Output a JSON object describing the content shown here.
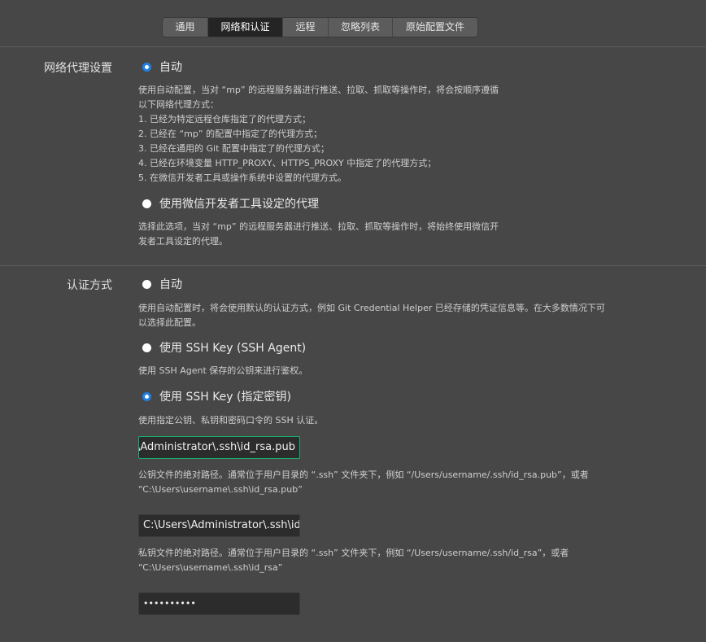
{
  "tabs": [
    {
      "label": "通用",
      "active": false
    },
    {
      "label": "网络和认证",
      "active": true
    },
    {
      "label": "远程",
      "active": false
    },
    {
      "label": "忽略列表",
      "active": false
    },
    {
      "label": "原始配置文件",
      "active": false
    }
  ],
  "proxy": {
    "label": "网络代理设置",
    "options": [
      {
        "label": "自动",
        "checked": true,
        "desc_lines": [
          "使用自动配置，当对 “mp” 的远程服务器进行推送、拉取、抓取等操作时，将会按顺序遵循",
          "以下网络代理方式：",
          "1. 已经为特定远程仓库指定了的代理方式；",
          "2. 已经在 “mp” 的配置中指定了的代理方式；",
          "3. 已经在通用的 Git 配置中指定了的代理方式；",
          "4. 已经在环境变量 HTTP_PROXY、HTTPS_PROXY 中指定了的代理方式；",
          "5. 在微信开发者工具或操作系统中设置的代理方式。"
        ]
      },
      {
        "label": "使用微信开发者工具设定的代理",
        "checked": false,
        "desc_lines": [
          "选择此选项，当对 “mp” 的远程服务器进行推送、拉取、抓取等操作时，将始终使用微信开",
          "发者工具设定的代理。"
        ]
      }
    ]
  },
  "auth": {
    "label": "认证方式",
    "options": [
      {
        "label": "自动",
        "checked": false,
        "desc_lines": [
          "使用自动配置时，将会使用默认的认证方式，例如 Git Credential Helper 已经存储的凭证信息等。在大多数情况下可",
          "以选择此配置。"
        ]
      },
      {
        "label": "使用 SSH Key (SSH Agent)",
        "checked": false,
        "desc_lines": [
          "使用 SSH Agent 保存的公钥来进行鉴权。"
        ]
      },
      {
        "label": "使用 SSH Key (指定密钥)",
        "checked": true,
        "desc_lines": [
          "使用指定公钥、私钥和密码口令的 SSH 认证。"
        ]
      }
    ],
    "public_key": {
      "value": "C:\\Users\\Administrator\\.ssh\\id_rsa.pub",
      "help_lines": [
        "公钥文件的绝对路径。通常位于用户目录的 “.ssh” 文件夹下，例如 “/Users/username/.ssh/id_rsa.pub”，或者",
        "“C:\\Users\\username\\.ssh\\id_rsa.pub”"
      ]
    },
    "private_key": {
      "value": "C:\\Users\\Administrator\\.ssh\\id_",
      "help_lines": [
        "私钥文件的绝对路径。通常位于用户目录的 “.ssh” 文件夹下，例如 “/Users/username/.ssh/id_rsa”，或者",
        "“C:\\Users\\username\\.ssh\\id_rsa”"
      ]
    },
    "passphrase": {
      "value": "••••••••••"
    }
  }
}
